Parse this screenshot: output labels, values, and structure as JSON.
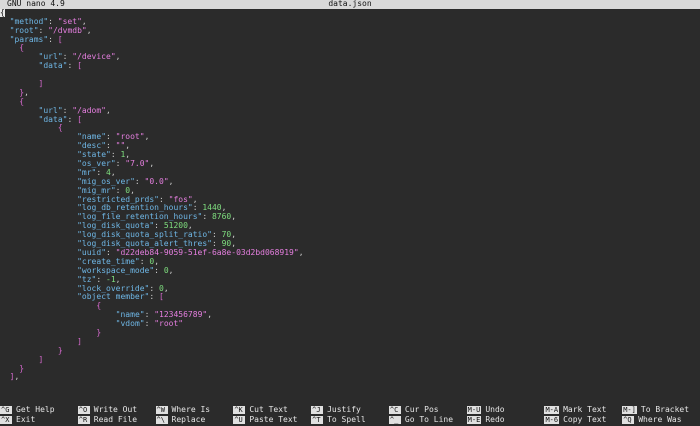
{
  "titlebar": {
    "app": "GNU nano 4.9",
    "filename": "data.json"
  },
  "colors": {
    "background": "#2b2b2b",
    "key": "#6fb7e6",
    "string": "#e67fe0",
    "number": "#7fdf7f",
    "bracket": "#d86ad0"
  },
  "lines": [
    {
      "indent": 0,
      "tokens": [
        {
          "t": "{",
          "c": "cursor"
        }
      ]
    },
    {
      "indent": 2,
      "tokens": [
        {
          "t": "\"method\"",
          "c": "k"
        },
        {
          "t": ": ",
          "c": "w"
        },
        {
          "t": "\"set\"",
          "c": "s"
        },
        {
          "t": ",",
          "c": "w"
        }
      ]
    },
    {
      "indent": 2,
      "tokens": [
        {
          "t": "\"root\"",
          "c": "k"
        },
        {
          "t": ": ",
          "c": "w"
        },
        {
          "t": "\"/dvmdb\"",
          "c": "s"
        },
        {
          "t": ",",
          "c": "w"
        }
      ]
    },
    {
      "indent": 2,
      "tokens": [
        {
          "t": "\"params\"",
          "c": "k"
        },
        {
          "t": ": ",
          "c": "w"
        },
        {
          "t": "[",
          "c": "p"
        }
      ]
    },
    {
      "indent": 4,
      "tokens": [
        {
          "t": "{",
          "c": "p"
        }
      ]
    },
    {
      "indent": 8,
      "tokens": [
        {
          "t": "\"url\"",
          "c": "k"
        },
        {
          "t": ": ",
          "c": "w"
        },
        {
          "t": "\"/device\"",
          "c": "s"
        },
        {
          "t": ",",
          "c": "w"
        }
      ]
    },
    {
      "indent": 8,
      "tokens": [
        {
          "t": "\"data\"",
          "c": "k"
        },
        {
          "t": ": ",
          "c": "w"
        },
        {
          "t": "[",
          "c": "p"
        }
      ]
    },
    {
      "indent": 0,
      "tokens": []
    },
    {
      "indent": 8,
      "tokens": [
        {
          "t": "]",
          "c": "p"
        }
      ]
    },
    {
      "indent": 4,
      "tokens": [
        {
          "t": "}",
          "c": "p"
        },
        {
          "t": ",",
          "c": "w"
        }
      ]
    },
    {
      "indent": 4,
      "tokens": [
        {
          "t": "{",
          "c": "p"
        }
      ]
    },
    {
      "indent": 8,
      "tokens": [
        {
          "t": "\"url\"",
          "c": "k"
        },
        {
          "t": ": ",
          "c": "w"
        },
        {
          "t": "\"/adom\"",
          "c": "s"
        },
        {
          "t": ",",
          "c": "w"
        }
      ]
    },
    {
      "indent": 8,
      "tokens": [
        {
          "t": "\"data\"",
          "c": "k"
        },
        {
          "t": ": ",
          "c": "w"
        },
        {
          "t": "[",
          "c": "p"
        }
      ]
    },
    {
      "indent": 12,
      "tokens": [
        {
          "t": "{",
          "c": "p"
        }
      ]
    },
    {
      "indent": 16,
      "tokens": [
        {
          "t": "\"name\"",
          "c": "k"
        },
        {
          "t": ": ",
          "c": "w"
        },
        {
          "t": "\"root\"",
          "c": "s"
        },
        {
          "t": ",",
          "c": "w"
        }
      ]
    },
    {
      "indent": 16,
      "tokens": [
        {
          "t": "\"desc\"",
          "c": "k"
        },
        {
          "t": ": ",
          "c": "w"
        },
        {
          "t": "\"\"",
          "c": "s"
        },
        {
          "t": ",",
          "c": "w"
        }
      ]
    },
    {
      "indent": 16,
      "tokens": [
        {
          "t": "\"state\"",
          "c": "k"
        },
        {
          "t": ": ",
          "c": "w"
        },
        {
          "t": "1",
          "c": "n"
        },
        {
          "t": ",",
          "c": "w"
        }
      ]
    },
    {
      "indent": 16,
      "tokens": [
        {
          "t": "\"os_ver\"",
          "c": "k"
        },
        {
          "t": ": ",
          "c": "w"
        },
        {
          "t": "\"7.0\"",
          "c": "s"
        },
        {
          "t": ",",
          "c": "w"
        }
      ]
    },
    {
      "indent": 16,
      "tokens": [
        {
          "t": "\"mr\"",
          "c": "k"
        },
        {
          "t": ": ",
          "c": "w"
        },
        {
          "t": "4",
          "c": "n"
        },
        {
          "t": ",",
          "c": "w"
        }
      ]
    },
    {
      "indent": 16,
      "tokens": [
        {
          "t": "\"mig_os_ver\"",
          "c": "k"
        },
        {
          "t": ": ",
          "c": "w"
        },
        {
          "t": "\"0.0\"",
          "c": "s"
        },
        {
          "t": ",",
          "c": "w"
        }
      ]
    },
    {
      "indent": 16,
      "tokens": [
        {
          "t": "\"mig_mr\"",
          "c": "k"
        },
        {
          "t": ": ",
          "c": "w"
        },
        {
          "t": "0",
          "c": "n"
        },
        {
          "t": ",",
          "c": "w"
        }
      ]
    },
    {
      "indent": 16,
      "tokens": [
        {
          "t": "\"restricted_prds\"",
          "c": "k"
        },
        {
          "t": ": ",
          "c": "w"
        },
        {
          "t": "\"fos\"",
          "c": "s"
        },
        {
          "t": ",",
          "c": "w"
        }
      ]
    },
    {
      "indent": 16,
      "tokens": [
        {
          "t": "\"log_db_retention_hours\"",
          "c": "k"
        },
        {
          "t": ": ",
          "c": "w"
        },
        {
          "t": "1440",
          "c": "n"
        },
        {
          "t": ",",
          "c": "w"
        }
      ]
    },
    {
      "indent": 16,
      "tokens": [
        {
          "t": "\"log_file_retention_hours\"",
          "c": "k"
        },
        {
          "t": ": ",
          "c": "w"
        },
        {
          "t": "8760",
          "c": "n"
        },
        {
          "t": ",",
          "c": "w"
        }
      ]
    },
    {
      "indent": 16,
      "tokens": [
        {
          "t": "\"log_disk_quota\"",
          "c": "k"
        },
        {
          "t": ": ",
          "c": "w"
        },
        {
          "t": "51200",
          "c": "n"
        },
        {
          "t": ",",
          "c": "w"
        }
      ]
    },
    {
      "indent": 16,
      "tokens": [
        {
          "t": "\"log_disk_quota_split_ratio\"",
          "c": "k"
        },
        {
          "t": ": ",
          "c": "w"
        },
        {
          "t": "70",
          "c": "n"
        },
        {
          "t": ",",
          "c": "w"
        }
      ]
    },
    {
      "indent": 16,
      "tokens": [
        {
          "t": "\"log_disk_quota_alert_thres\"",
          "c": "k"
        },
        {
          "t": ": ",
          "c": "w"
        },
        {
          "t": "90",
          "c": "n"
        },
        {
          "t": ",",
          "c": "w"
        }
      ]
    },
    {
      "indent": 16,
      "tokens": [
        {
          "t": "\"uuid\"",
          "c": "k"
        },
        {
          "t": ": ",
          "c": "w"
        },
        {
          "t": "\"d22deb84-9059-51ef-6a8e-03d2bd068919\"",
          "c": "s"
        },
        {
          "t": ",",
          "c": "w"
        }
      ]
    },
    {
      "indent": 16,
      "tokens": [
        {
          "t": "\"create_time\"",
          "c": "k"
        },
        {
          "t": ": ",
          "c": "w"
        },
        {
          "t": "0",
          "c": "n"
        },
        {
          "t": ",",
          "c": "w"
        }
      ]
    },
    {
      "indent": 16,
      "tokens": [
        {
          "t": "\"workspace_mode\"",
          "c": "k"
        },
        {
          "t": ": ",
          "c": "w"
        },
        {
          "t": "0",
          "c": "n"
        },
        {
          "t": ",",
          "c": "w"
        }
      ]
    },
    {
      "indent": 16,
      "tokens": [
        {
          "t": "\"tz\"",
          "c": "k"
        },
        {
          "t": ": ",
          "c": "w"
        },
        {
          "t": "-1",
          "c": "n"
        },
        {
          "t": ",",
          "c": "w"
        }
      ]
    },
    {
      "indent": 16,
      "tokens": [
        {
          "t": "\"lock_override\"",
          "c": "k"
        },
        {
          "t": ": ",
          "c": "w"
        },
        {
          "t": "0",
          "c": "n"
        },
        {
          "t": ",",
          "c": "w"
        }
      ]
    },
    {
      "indent": 16,
      "tokens": [
        {
          "t": "\"object member\"",
          "c": "k"
        },
        {
          "t": ": ",
          "c": "w"
        },
        {
          "t": "[",
          "c": "p"
        }
      ]
    },
    {
      "indent": 20,
      "tokens": [
        {
          "t": "{",
          "c": "p"
        }
      ]
    },
    {
      "indent": 24,
      "tokens": [
        {
          "t": "\"name\"",
          "c": "k"
        },
        {
          "t": ": ",
          "c": "w"
        },
        {
          "t": "\"123456789\"",
          "c": "s"
        },
        {
          "t": ",",
          "c": "w"
        }
      ]
    },
    {
      "indent": 24,
      "tokens": [
        {
          "t": "\"vdom\"",
          "c": "k"
        },
        {
          "t": ": ",
          "c": "w"
        },
        {
          "t": "\"root\"",
          "c": "s"
        }
      ]
    },
    {
      "indent": 20,
      "tokens": [
        {
          "t": "}",
          "c": "p"
        }
      ]
    },
    {
      "indent": 16,
      "tokens": [
        {
          "t": "]",
          "c": "p"
        }
      ]
    },
    {
      "indent": 12,
      "tokens": [
        {
          "t": "}",
          "c": "p"
        }
      ]
    },
    {
      "indent": 8,
      "tokens": [
        {
          "t": "]",
          "c": "p"
        }
      ]
    },
    {
      "indent": 4,
      "tokens": [
        {
          "t": "}",
          "c": "p"
        }
      ]
    },
    {
      "indent": 2,
      "tokens": [
        {
          "t": "]",
          "c": "p"
        },
        {
          "t": ",",
          "c": "w"
        }
      ]
    }
  ],
  "shortcuts": [
    [
      {
        "key": "^G",
        "label": "Get Help"
      },
      {
        "key": "^X",
        "label": "Exit"
      }
    ],
    [
      {
        "key": "^O",
        "label": "Write Out"
      },
      {
        "key": "^R",
        "label": "Read File"
      }
    ],
    [
      {
        "key": "^W",
        "label": "Where Is"
      },
      {
        "key": "^\\",
        "label": "Replace"
      }
    ],
    [
      {
        "key": "^K",
        "label": "Cut Text"
      },
      {
        "key": "^U",
        "label": "Paste Text"
      }
    ],
    [
      {
        "key": "^J",
        "label": "Justify"
      },
      {
        "key": "^T",
        "label": "To Spell"
      }
    ],
    [
      {
        "key": "^C",
        "label": "Cur Pos"
      },
      {
        "key": "^_",
        "label": "Go To Line"
      }
    ],
    [
      {
        "key": "M-U",
        "label": "Undo"
      },
      {
        "key": "M-E",
        "label": "Redo"
      }
    ],
    [
      {
        "key": "M-A",
        "label": "Mark Text"
      },
      {
        "key": "M-6",
        "label": "Copy Text"
      }
    ],
    [
      {
        "key": "M-]",
        "label": "To Bracket"
      },
      {
        "key": "^Q",
        "label": "Where Was"
      }
    ]
  ]
}
